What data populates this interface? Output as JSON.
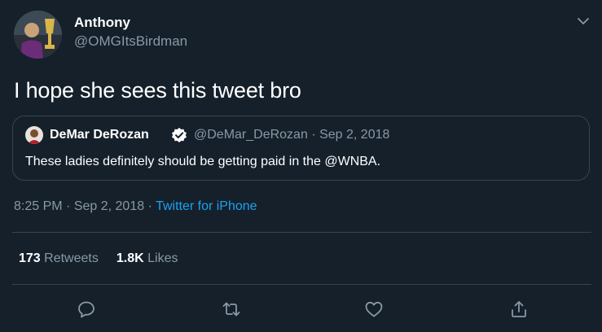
{
  "author": {
    "name": "Anthony",
    "handle": "@OMGItsBirdman",
    "avatar_icon": "user-avatar"
  },
  "tweet": {
    "text": "I hope she sees this tweet bro"
  },
  "quoted_tweet": {
    "name": "DeMar DeRozan",
    "verified_icon": "verified-badge-icon",
    "handle": "@DeMar_DeRozan",
    "separator": "·",
    "date": "Sep 2, 2018",
    "text": "These ladies definitely should be getting paid in the @WNBA."
  },
  "meta": {
    "time": "8:25 PM",
    "separator": "·",
    "date": "Sep 2, 2018",
    "source": "Twitter for iPhone"
  },
  "stats": {
    "retweets_count": "173",
    "retweets_label": "Retweets",
    "likes_count": "1.8K",
    "likes_label": "Likes"
  },
  "actions": [
    "reply-icon",
    "retweet-icon",
    "like-icon",
    "share-icon"
  ],
  "colors": {
    "background": "#15202b",
    "border": "#38444d",
    "secondary_text": "#8899a6",
    "link": "#1da1f2"
  }
}
